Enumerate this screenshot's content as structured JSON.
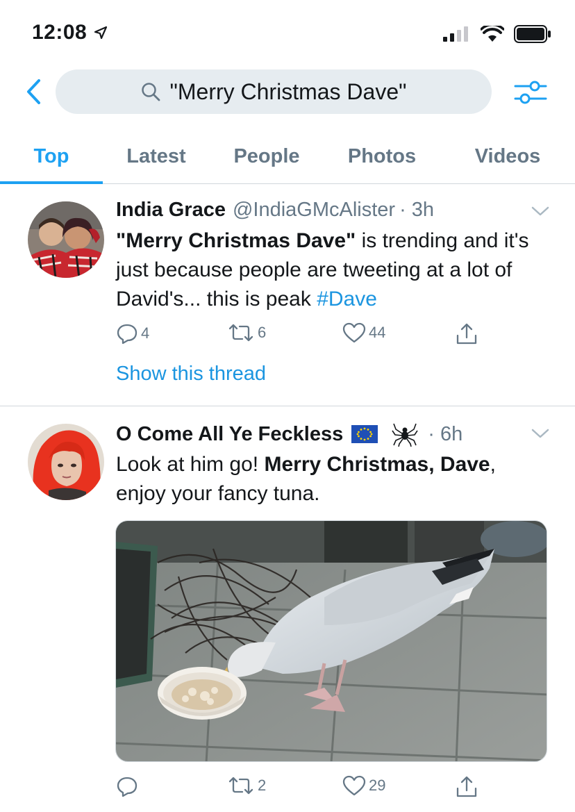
{
  "status_bar": {
    "time": "12:08"
  },
  "search": {
    "query": "\"Merry Christmas Dave\""
  },
  "tabs": [
    {
      "label": "Top",
      "active": true
    },
    {
      "label": "Latest"
    },
    {
      "label": "People"
    },
    {
      "label": "Photos"
    },
    {
      "label": "Videos"
    }
  ],
  "tweets": [
    {
      "name": "India Grace",
      "handle": "@IndiaGMcAlister",
      "time": "· 3h",
      "text": {
        "quote_bold": "\"Merry Christmas Dave\"",
        "rest": " is trending and it's just because people are tweeting at a lot of David's... this is peak ",
        "hashtag": "#Dave"
      },
      "replies": "4",
      "retweets": "6",
      "likes": "44",
      "show_thread": "Show this thread"
    },
    {
      "name": "O Come All Ye Feckless",
      "time": "· 6h",
      "text": {
        "pre": "Look at him go! ",
        "bold": "Merry Christmas, Dave",
        "post": ", enjoy your fancy tuna."
      },
      "replies": "",
      "retweets": "2",
      "likes": "29"
    }
  ],
  "colors": {
    "accent": "#1da1f2",
    "link": "#1b95e0",
    "secondary_text": "#657786",
    "search_bg": "#e6ecf0"
  }
}
